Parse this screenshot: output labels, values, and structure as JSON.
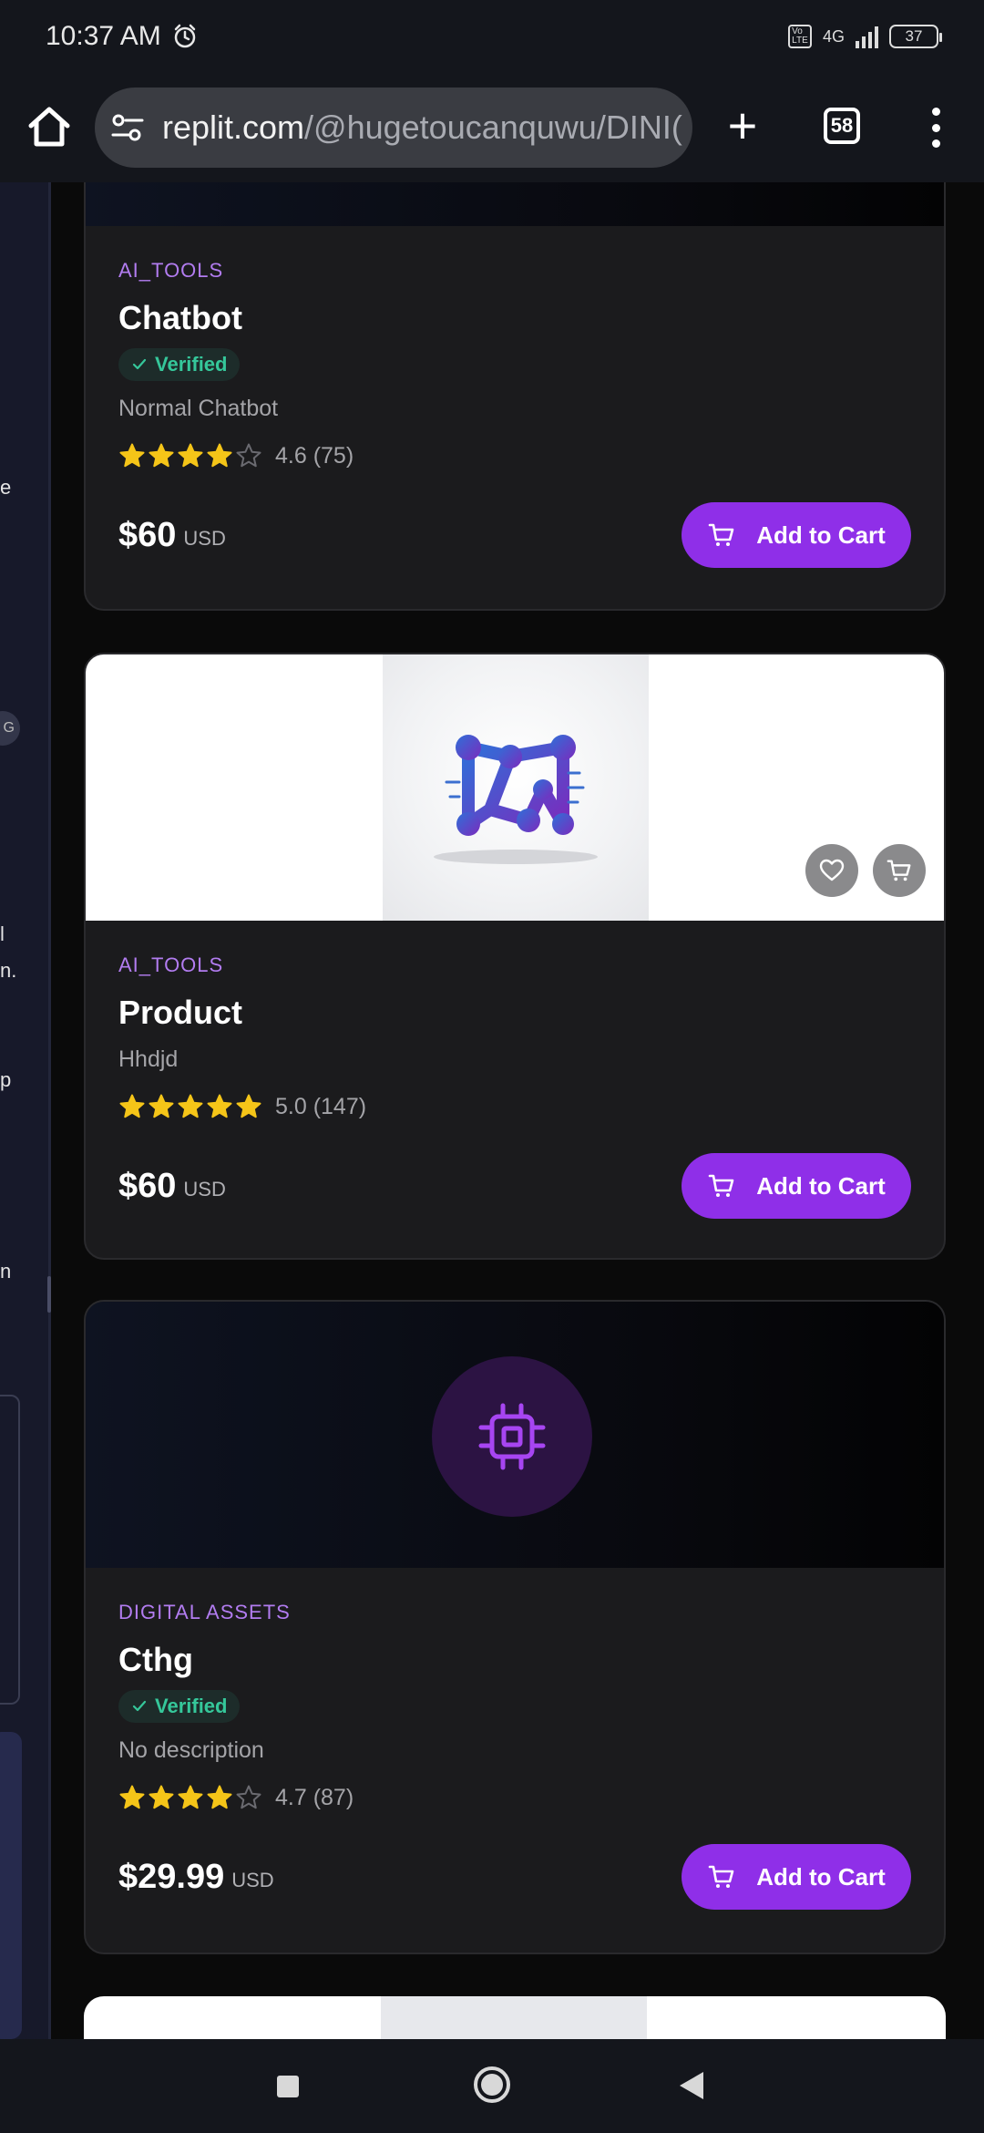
{
  "status_bar": {
    "time": "10:37 AM",
    "network": "4G",
    "volte": "Vo LTE",
    "battery": "37"
  },
  "browser": {
    "url_domain": "replit.com",
    "url_path": "/@hugetoucanquwu/DINI(",
    "tab_count": "58"
  },
  "sidebar_fragments": [
    "e",
    "l",
    "n.",
    "p",
    "n"
  ],
  "sidebar_badge": "G",
  "products": [
    {
      "category": "AI_TOOLS",
      "title": "Chatbot",
      "verified": "Verified",
      "description": "Normal Chatbot",
      "rating": 4.6,
      "stars_filled": 4,
      "rating_text": "4.6 (75)",
      "price": "$60",
      "currency": "USD",
      "add_label": "Add to Cart"
    },
    {
      "category": "AI_TOOLS",
      "title": "Product",
      "description": "Hhdjd",
      "rating": 5.0,
      "stars_filled": 5,
      "rating_text": "5.0 (147)",
      "price": "$60",
      "currency": "USD",
      "add_label": "Add to Cart"
    },
    {
      "category": "DIGITAL ASSETS",
      "title": "Cthg",
      "verified": "Verified",
      "description": "No description",
      "rating": 4.7,
      "stars_filled": 4,
      "rating_text": "4.7 (87)",
      "price": "$29.99",
      "currency": "USD",
      "add_label": "Add to Cart"
    }
  ],
  "icons": {
    "wishlist": "heart-icon",
    "quick_cart": "cart-icon",
    "category_art": "cpu-chip-icon"
  },
  "colors": {
    "accent": "#8f2fe8",
    "category": "#b27cf0",
    "verified": "#35c79a",
    "star": "#f5c518",
    "card_bg": "#1b1b1d"
  }
}
